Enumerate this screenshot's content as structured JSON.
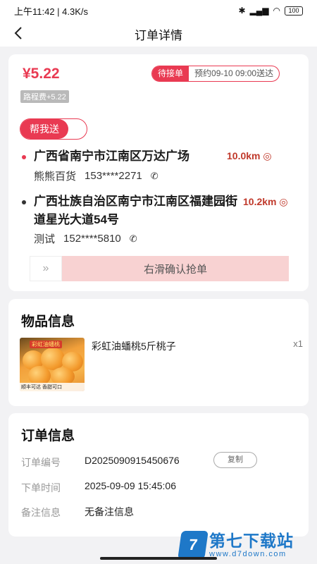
{
  "status_bar": {
    "time_speed": "上午11:42 | 4.3K/s",
    "battery": "100"
  },
  "nav": {
    "title": "订单详情"
  },
  "order": {
    "price": "¥5.22",
    "fee": "路程费+5.22",
    "status_tag": "待接单",
    "schedule_tag": "预约09-10 09:00送达",
    "help_label": "帮我送",
    "pickup": {
      "address": "广西省南宁市江南区万达广场",
      "distance": "10.0km",
      "name": "熊熊百货",
      "phone": "153****2271"
    },
    "dropoff": {
      "address": "广西壮族自治区南宁市江南区福建园街道星光大道54号",
      "distance": "10.2km",
      "name": "测试",
      "phone": "152****5810"
    },
    "slider_text": "右滑确认抢单"
  },
  "goods": {
    "title": "物品信息",
    "item_name": "彩虹油蟠桃5斤桃子",
    "qty": "x1",
    "image_banner": "彩虹油蟠桃",
    "image_footer": "顺丰可达 香甜可口"
  },
  "info": {
    "title": "订单信息",
    "rows": [
      {
        "label": "订单编号",
        "value": "D2025090915450676"
      },
      {
        "label": "下单时间",
        "value": "2025-09-09 15:45:06"
      },
      {
        "label": "备注信息",
        "value": "无备注信息"
      }
    ],
    "copy_label": "复制"
  },
  "watermark": {
    "logo_char": "7",
    "name": "第七下载站",
    "url": "www.d7down.com"
  },
  "colors": {
    "accent": "#e93a52",
    "slider_bg": "#f8d2d2",
    "watermark": "#1e78c8"
  }
}
